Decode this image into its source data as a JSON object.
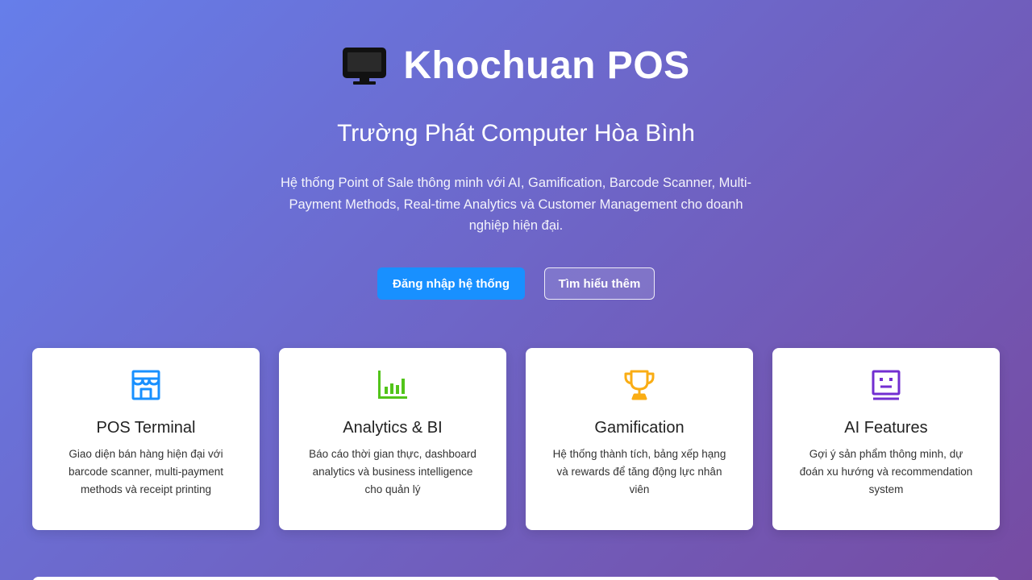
{
  "hero": {
    "title": "Khochuan POS",
    "title_icon": "desktop-icon",
    "subtitle": "Trường Phát Computer Hòa Bình",
    "description": "Hệ thống Point of Sale thông minh với AI, Gamification, Barcode Scanner, Multi-Payment Methods, Real-time Analytics và Customer Management cho doanh nghiệp hiện đại.",
    "login_button": "Đăng nhập hệ thống",
    "learn_more_button": "Tìm hiểu thêm"
  },
  "colors": {
    "gradient_start": "#667eea",
    "gradient_end": "#764ba2",
    "primary_button": "#1890ff",
    "pos_icon": "#1890ff",
    "analytics_icon": "#52c41a",
    "gamification_icon": "#faad14",
    "ai_icon": "#722ed1"
  },
  "features": [
    {
      "icon": "shop-icon",
      "title": "POS Terminal",
      "description": "Giao diện bán hàng hiện đại với barcode scanner, multi-payment methods và receipt printing"
    },
    {
      "icon": "bar-chart-icon",
      "title": "Analytics & BI",
      "description": "Báo cáo thời gian thực, dashboard analytics và business intelligence cho quản lý"
    },
    {
      "icon": "trophy-icon",
      "title": "Gamification",
      "description": "Hệ thống thành tích, bảng xếp hạng và rewards để tăng động lực nhân viên"
    },
    {
      "icon": "robot-icon",
      "title": "AI Features",
      "description": "Gợi ý sản phẩm thông minh, dự đoán xu hướng và recommendation system"
    }
  ]
}
